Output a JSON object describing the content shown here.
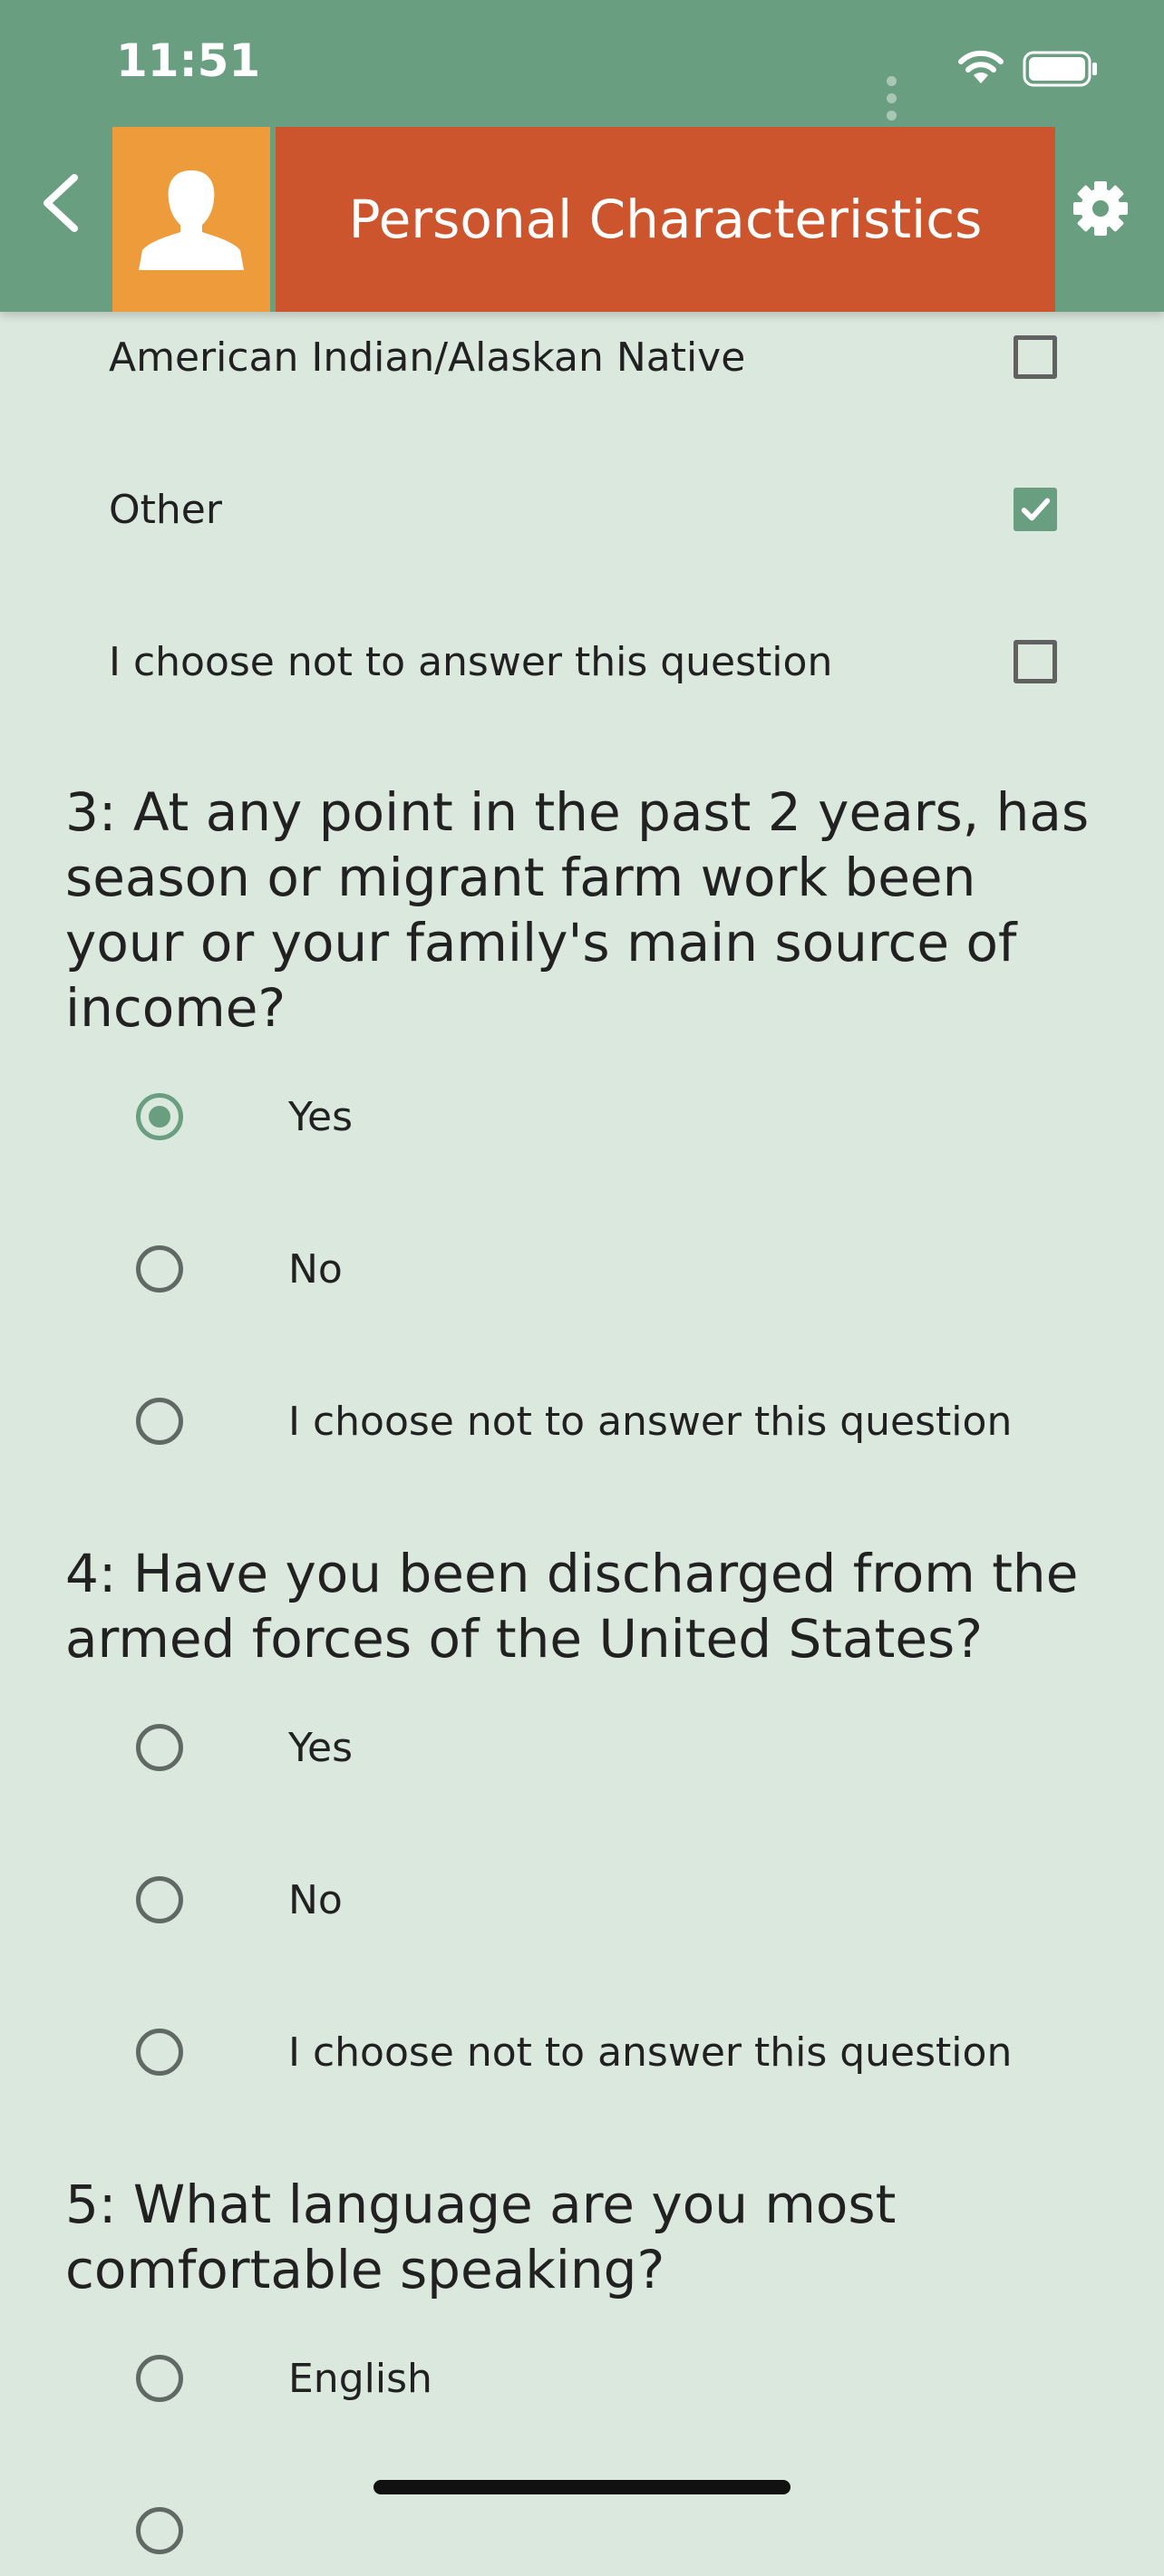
{
  "status_bar": {
    "time": "11:51"
  },
  "header": {
    "title": "Personal Characteristics"
  },
  "question2_options": [
    {
      "label": "American Indian/Alaskan Native",
      "checked": false
    },
    {
      "label": "Other",
      "checked": true
    },
    {
      "label": "I choose not to answer this question",
      "checked": false
    }
  ],
  "question3": {
    "text": "3: At any point in the past 2 years, has season or migrant farm work been your or your family's main source of income?",
    "options": [
      {
        "label": "Yes",
        "selected": true
      },
      {
        "label": "No",
        "selected": false
      },
      {
        "label": "I choose not to answer this question",
        "selected": false
      }
    ]
  },
  "question4": {
    "text": "4: Have you been discharged from the armed forces of the United States?",
    "options": [
      {
        "label": "Yes",
        "selected": false
      },
      {
        "label": "No",
        "selected": false
      },
      {
        "label": "I choose not to answer this question",
        "selected": false
      }
    ]
  },
  "question5": {
    "text": "5: What language are you most comfortable speaking?",
    "options": [
      {
        "label": "English",
        "selected": false
      }
    ]
  },
  "colors": {
    "primary": "#699f80",
    "title_bg": "#cc552d",
    "avatar_bg": "#ee9b3b",
    "background": "#dbe8de"
  },
  "icons": {
    "back": "chevron-left-icon",
    "avatar": "person-icon",
    "settings": "gear-icon"
  }
}
